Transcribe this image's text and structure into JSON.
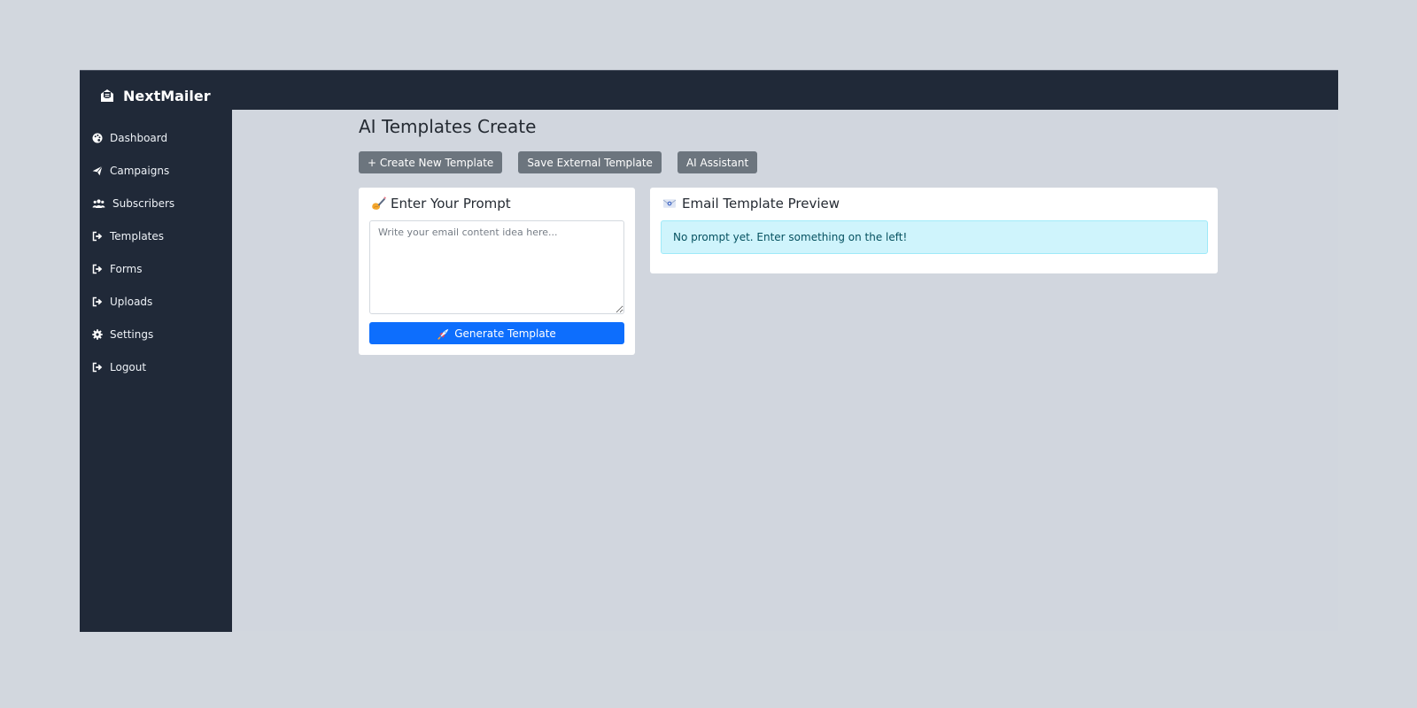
{
  "app": {
    "brand": "NextMailer",
    "brand_icon": "envelope-open-icon"
  },
  "sidebar": {
    "items": [
      {
        "label": "Dashboard",
        "icon": "palette-icon"
      },
      {
        "label": "Campaigns",
        "icon": "paper-plane-icon"
      },
      {
        "label": "Subscribers",
        "icon": "users-icon"
      },
      {
        "label": "Templates",
        "icon": "sign-out-icon"
      },
      {
        "label": "Forms",
        "icon": "sign-out-icon"
      },
      {
        "label": "Uploads",
        "icon": "sign-out-icon"
      },
      {
        "label": "Settings",
        "icon": "gear-icon"
      },
      {
        "label": "Logout",
        "icon": "sign-out-icon"
      }
    ]
  },
  "main": {
    "title": "AI Templates Create",
    "toolbar": {
      "create_label": "+ Create New Template",
      "save_external_label": "Save External Template",
      "assistant_label": "AI Assistant"
    },
    "prompt_card": {
      "icon": "writing-hand-icon",
      "title": "Enter Your Prompt",
      "textarea_value": "",
      "textarea_placeholder": "Write your email content idea here...",
      "generate_icon": "rocket-icon",
      "generate_label": "Generate Template"
    },
    "preview_card": {
      "icon": "envelope-icon",
      "title": "Email Template Preview",
      "empty_message": "No prompt yet. Enter something on the left!"
    }
  },
  "colors": {
    "page_background": "#d2d7de",
    "sidebar": "#202938",
    "secondary_button": "#6c757e",
    "primary_button": "#0d6efd",
    "info_alert_background": "#cff4fc",
    "info_alert_text": "#055160"
  }
}
